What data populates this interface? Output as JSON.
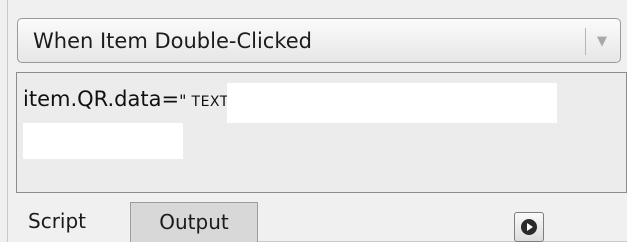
{
  "event_select": {
    "selected": "When Item Double-Clicked",
    "chevron_icon": "chevron-down-icon"
  },
  "script_editor": {
    "code_prefix": "item.QR.data=",
    "quote_open": "\"",
    "text_value": "TEXT",
    "quote_close": "\""
  },
  "tabs": [
    {
      "label": "Script",
      "active": true
    },
    {
      "label": "Output",
      "active": false
    }
  ],
  "run_button": {
    "icon": "play-circle-icon"
  }
}
